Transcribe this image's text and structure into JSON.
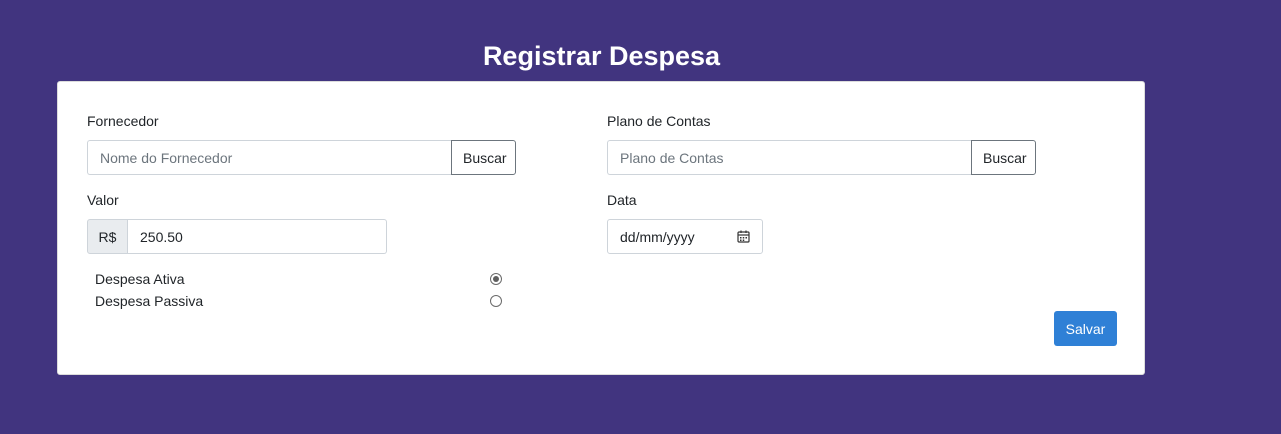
{
  "page": {
    "title": "Registrar Despesa"
  },
  "form": {
    "fornecedor": {
      "label": "Fornecedor",
      "placeholder": "Nome do Fornecedor",
      "button_label": "Buscar"
    },
    "plano_contas": {
      "label": "Plano de Contas",
      "placeholder": "Plano de Contas",
      "button_label": "Buscar"
    },
    "valor": {
      "label": "Valor",
      "prefix": "R$",
      "value": "250.50"
    },
    "data": {
      "label": "Data",
      "placeholder": "dd/mm/yyyy"
    },
    "tipo": {
      "options": [
        {
          "label": "Despesa Ativa",
          "checked": true
        },
        {
          "label": "Despesa Passiva",
          "checked": false
        }
      ]
    },
    "submit_label": "Salvar"
  },
  "colors": {
    "background": "#41347f",
    "primary": "#2f80d6"
  }
}
